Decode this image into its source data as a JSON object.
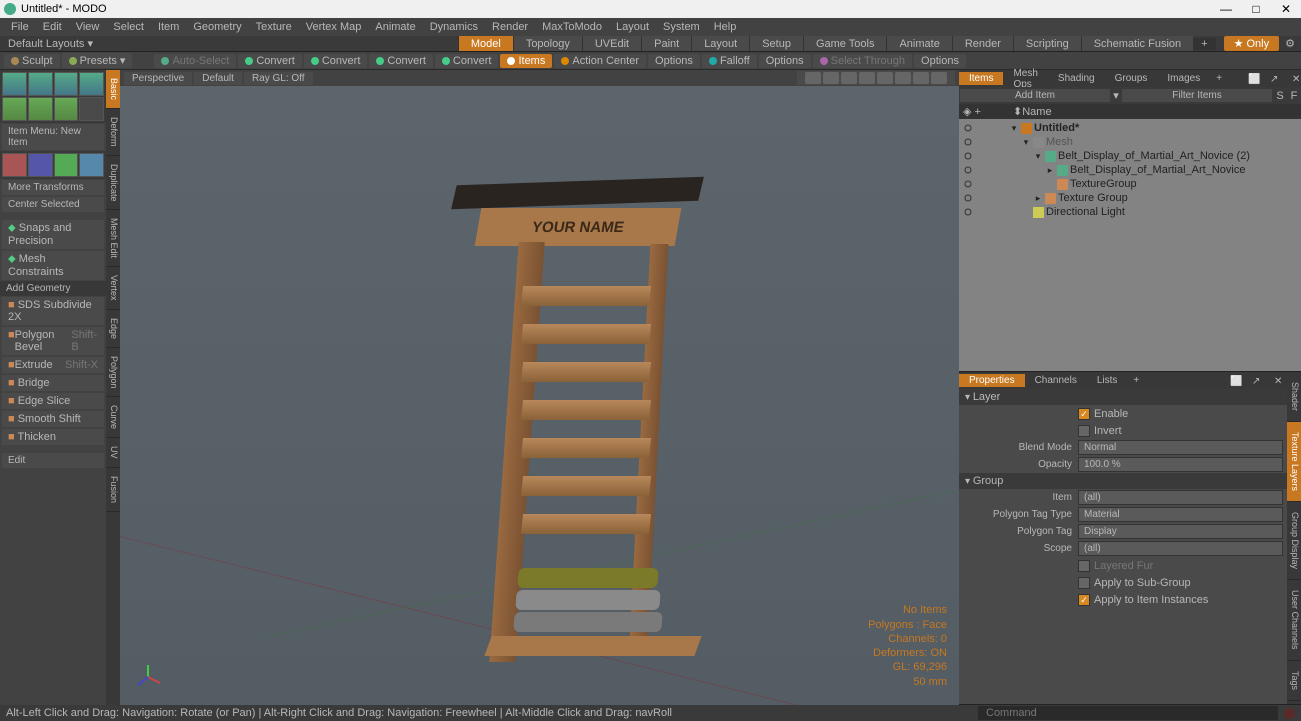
{
  "window": {
    "title": "Untitled* - MODO",
    "min": "—",
    "max": "□",
    "close": "✕"
  },
  "menu": [
    "File",
    "Edit",
    "View",
    "Select",
    "Item",
    "Geometry",
    "Texture",
    "Vertex Map",
    "Animate",
    "Dynamics",
    "Render",
    "MaxToModo",
    "Layout",
    "System",
    "Help"
  ],
  "layouts": {
    "name": "Default Layouts ▾",
    "tabs": [
      "Model",
      "Topology",
      "UVEdit",
      "Paint",
      "Layout",
      "Setup",
      "Game Tools",
      "Animate",
      "Render",
      "Scripting",
      "Schematic Fusion"
    ],
    "active": 0,
    "only": "★ Only"
  },
  "toolbar": {
    "sculpt": "Sculpt",
    "presets": "Presets ▾",
    "autoselect": "Auto-Select",
    "convert1": "Convert",
    "convert2": "Convert",
    "convert3": "Convert",
    "convert4": "Convert",
    "items": "Items",
    "actioncenter": "Action Center",
    "options1": "Options",
    "falloff": "Falloff",
    "options2": "Options",
    "selectthrough": "Select Through",
    "options3": "Options"
  },
  "left": {
    "tabs": [
      "Basic",
      "Deform",
      "Duplicate",
      "Mesh Edit",
      "Vertex",
      "Edge",
      "Polygon",
      "Curve",
      "UV",
      "Fusion"
    ],
    "itemmenu": "Item Menu: New Item",
    "moretrans": "More Transforms",
    "centersel": "Center Selected",
    "snaps": "Snaps and Precision",
    "meshcon": "Mesh Constraints",
    "addgeo": "Add Geometry",
    "sds": "SDS Subdivide 2X",
    "polybevel": "Polygon Bevel",
    "polybevel_k": "Shift-B",
    "extrude": "Extrude",
    "extrude_k": "Shift-X",
    "bridge": "Bridge",
    "edgeslice": "Edge Slice",
    "smoothshift": "Smooth Shift",
    "thicken": "Thicken",
    "edit": "Edit"
  },
  "viewport": {
    "tabs": [
      "Perspective",
      "Default",
      "Ray GL: Off"
    ],
    "modeltext": "YOUR NAME",
    "stats": {
      "noitems": "No Items",
      "polys": "Polygons : Face",
      "channels": "Channels: 0",
      "deformers": "Deformers: ON",
      "gl": "GL: 69,296",
      "units": "50 mm"
    }
  },
  "items_panel": {
    "tabs": [
      "Items",
      "Mesh Ops",
      "Shading",
      "Groups",
      "Images"
    ],
    "additem": "Add Item",
    "filter": "Filter Items",
    "hdr_name": "Name",
    "tree": [
      {
        "depth": 0,
        "exp": "▾",
        "ic": "#c87820",
        "name": "Untitled*",
        "bold": true
      },
      {
        "depth": 1,
        "exp": "▾",
        "ic": "#888",
        "name": "Mesh",
        "dim": true
      },
      {
        "depth": 2,
        "exp": "▾",
        "ic": "#5a8",
        "name": "Belt_Display_of_Martial_Art_Novice",
        "suffix": " (2)"
      },
      {
        "depth": 3,
        "exp": "▸",
        "ic": "#5a8",
        "name": "Belt_Display_of_Martial_Art_Novice"
      },
      {
        "depth": 3,
        "exp": "",
        "ic": "#c85",
        "name": "TextureGroup"
      },
      {
        "depth": 2,
        "exp": "▸",
        "ic": "#c85",
        "name": "Texture Group"
      },
      {
        "depth": 1,
        "exp": "",
        "ic": "#cc5",
        "name": "Directional Light"
      }
    ]
  },
  "props": {
    "tabs": [
      "Properties",
      "Channels",
      "Lists"
    ],
    "rtabs": [
      "Shader",
      "Texture Layers",
      "Group Display",
      "User Channels",
      "Tags"
    ],
    "sec_layer": "Layer",
    "enable": "Enable",
    "invert": "Invert",
    "blendmode_l": "Blend Mode",
    "blendmode_v": "Normal",
    "opacity_l": "Opacity",
    "opacity_v": "100.0 %",
    "sec_group": "Group",
    "item_l": "Item",
    "item_v": "(all)",
    "ptt_l": "Polygon Tag Type",
    "ptt_v": "Material",
    "pt_l": "Polygon Tag",
    "pt_v": "Display",
    "scope_l": "Scope",
    "scope_v": "(all)",
    "layeredfur": "Layered Fur",
    "applysub": "Apply to Sub-Group",
    "applyinst": "Apply to Item Instances"
  },
  "status": {
    "hint": "Alt-Left Click and Drag: Navigation: Rotate (or Pan) | Alt-Right Click and Drag: Navigation: Freewheel | Alt-Middle Click and Drag: navRoll",
    "cmd": "Command"
  }
}
